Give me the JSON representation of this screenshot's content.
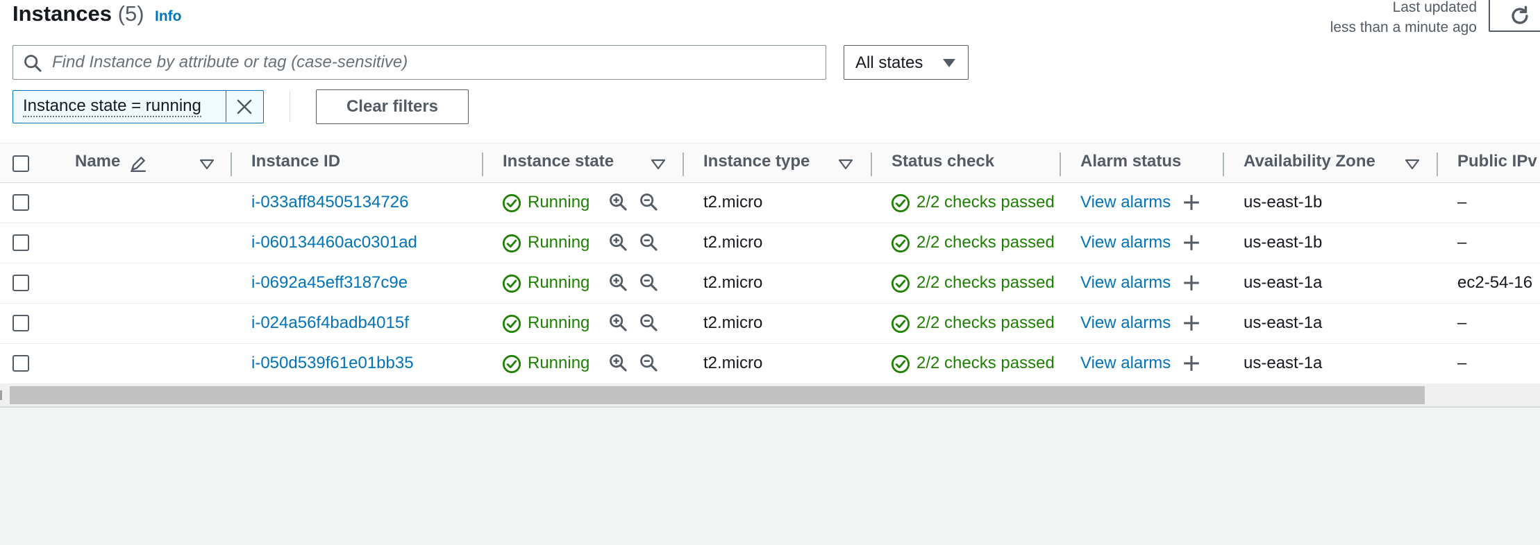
{
  "header": {
    "title": "Instances",
    "count": "(5)",
    "info_link": "Info",
    "last_updated_line1": "Last updated",
    "last_updated_line2": "less than a minute ago",
    "refresh_icon": "refresh-icon"
  },
  "search": {
    "placeholder": "Find Instance by attribute or tag (case-sensitive)",
    "value": "",
    "icon": "search-icon"
  },
  "state_filter": {
    "selected": "All states",
    "icon": "caret-down-icon"
  },
  "filter_token": {
    "label": "Instance state = running",
    "remove_icon": "close-icon"
  },
  "clear_filters_label": "Clear filters",
  "table": {
    "columns": [
      "Name",
      "Instance ID",
      "Instance state",
      "Instance type",
      "Status check",
      "Alarm status",
      "Availability Zone",
      "Public IPv"
    ],
    "rows": [
      {
        "name": "",
        "instance_id": "i-033aff84505134726",
        "state": "Running",
        "type": "t2.micro",
        "status_check": "2/2 checks passed",
        "alarm": "View alarms",
        "az": "us-east-1b",
        "public_ip": "–"
      },
      {
        "name": "",
        "instance_id": "i-060134460ac0301ad",
        "state": "Running",
        "type": "t2.micro",
        "status_check": "2/2 checks passed",
        "alarm": "View alarms",
        "az": "us-east-1b",
        "public_ip": "–"
      },
      {
        "name": "",
        "instance_id": "i-0692a45eff3187c9e",
        "state": "Running",
        "type": "t2.micro",
        "status_check": "2/2 checks passed",
        "alarm": "View alarms",
        "az": "us-east-1a",
        "public_ip": "ec2-54-16"
      },
      {
        "name": "",
        "instance_id": "i-024a56f4badb4015f",
        "state": "Running",
        "type": "t2.micro",
        "status_check": "2/2 checks passed",
        "alarm": "View alarms",
        "az": "us-east-1a",
        "public_ip": "–"
      },
      {
        "name": "",
        "instance_id": "i-050d539f61e01bb35",
        "state": "Running",
        "type": "t2.micro",
        "status_check": "2/2 checks passed",
        "alarm": "View alarms",
        "az": "us-east-1a",
        "public_ip": "–"
      }
    ]
  },
  "colors": {
    "link": "#0073bb",
    "success": "#1d8102",
    "header_text": "#545b64",
    "background": "#f2f3f3"
  }
}
